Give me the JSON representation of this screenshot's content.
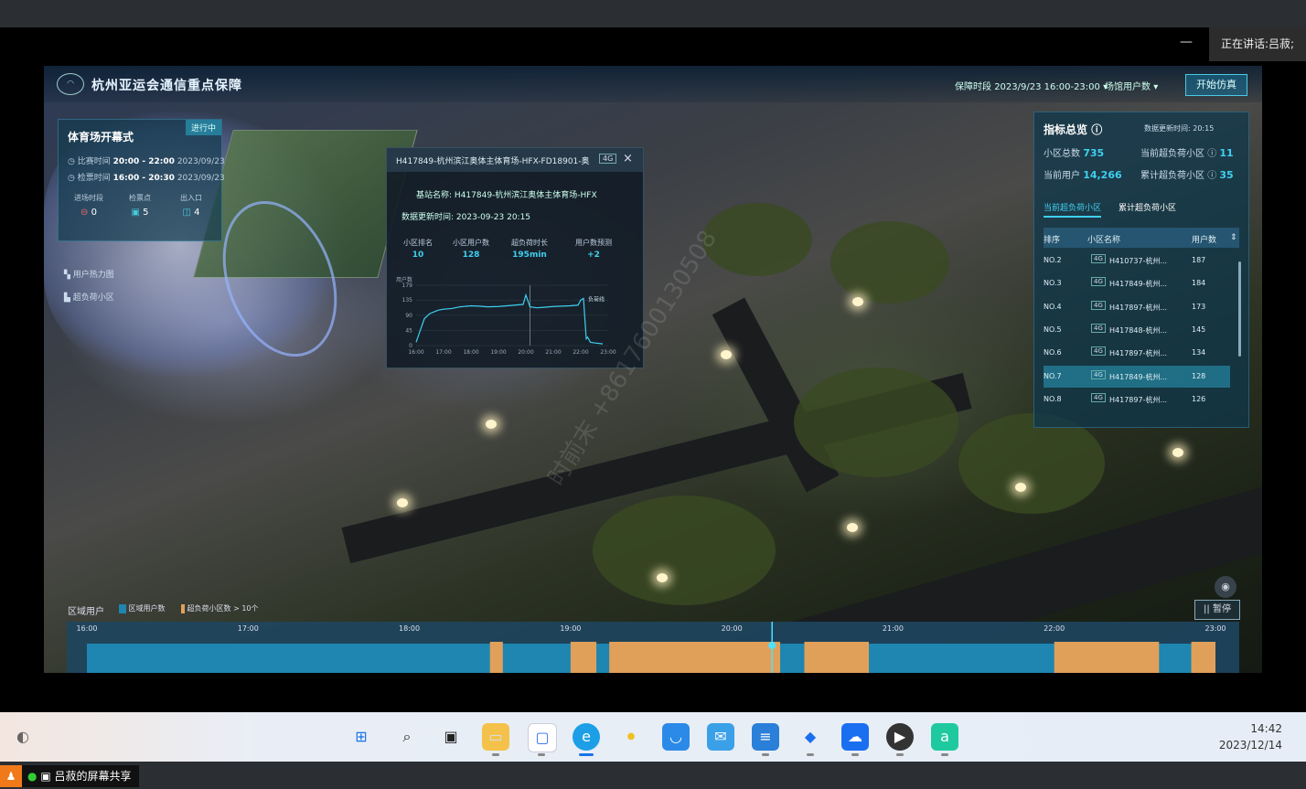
{
  "meeting": {
    "minimize_label": "—",
    "speaking_label": "正在讲话:",
    "speaker_name": "吕菽;",
    "share_label": "吕菽的屏幕共享"
  },
  "app": {
    "title": "杭州亚运会通信重点保障",
    "guard_period_label": "保障时段",
    "guard_period_value": "2023/9/23 16:00-23:00",
    "scene_label": "场馆用户数",
    "simulate_button": "开始仿真"
  },
  "event": {
    "title": "体育场开幕式",
    "status": "进行中",
    "match_time_label": "比赛时间",
    "match_time_value": "20:00 - 22:00",
    "match_date": "2023/09/23",
    "check_time_label": "检票时间",
    "check_time_value": "16:00 - 20:30",
    "check_date": "2023/09/23",
    "stats": [
      {
        "label": "进场时段",
        "value": "0",
        "icon": "clock-icon"
      },
      {
        "label": "检票点",
        "value": "5",
        "icon": "ticket-icon"
      },
      {
        "label": "出入口",
        "value": "4",
        "icon": "gate-icon"
      }
    ],
    "side_links": [
      "用户热力图",
      "超负荷小区"
    ]
  },
  "popup": {
    "cell_id": "H417849-杭州滨江奥体主体育场-HFX-FD18901-奥",
    "net": "4G",
    "close": "×",
    "station_label": "基站名称:",
    "station_value": "H417849-杭州滨江奥体主体育场-HFX",
    "update_label": "数据更新时间:",
    "update_value": "2023-09-23 20:15",
    "metrics": [
      {
        "label": "小区排名",
        "value": "10"
      },
      {
        "label": "小区用户数",
        "value": "128"
      },
      {
        "label": "超负荷时长",
        "value": "195min"
      },
      {
        "label": "用户数预测",
        "value": "+2"
      }
    ],
    "chart_ylabel": "用户数",
    "chart_series_label": "负荷线"
  },
  "chart_data": {
    "type": "line",
    "ylabel": "用户数",
    "x_ticks": [
      "16:00",
      "17:00",
      "18:00",
      "19:00",
      "20:00",
      "21:00",
      "22:00",
      "23:00"
    ],
    "y_ticks": [
      0,
      45,
      90,
      135,
      179
    ],
    "ylim": [
      0,
      179
    ],
    "series": [
      {
        "name": "负荷线",
        "color": "#3fd0f0",
        "x": [
          16.0,
          16.15,
          16.3,
          16.5,
          16.8,
          17.0,
          17.3,
          17.6,
          18.0,
          18.3,
          18.6,
          19.0,
          19.3,
          19.6,
          19.9,
          20.0,
          20.15,
          20.4,
          20.7,
          21.0,
          21.3,
          21.6,
          21.9,
          22.0,
          22.1,
          22.2,
          22.25,
          22.35,
          22.5,
          22.8
        ],
        "y": [
          10,
          45,
          80,
          95,
          105,
          108,
          110,
          115,
          118,
          117,
          115,
          116,
          118,
          120,
          122,
          150,
          115,
          112,
          114,
          116,
          117,
          118,
          120,
          135,
          140,
          20,
          25,
          10,
          8,
          5
        ]
      }
    ],
    "grid": true
  },
  "overview": {
    "title": "指标总览",
    "update_label": "数据更新时间:",
    "update_value": "20:15",
    "cells_total_label": "小区总数",
    "cells_total_value": "735",
    "current_over_label": "当前超负荷小区",
    "current_over_value": "11",
    "users_label": "当前用户",
    "users_value": "14,266",
    "cumulative_over_label": "累计超负荷小区",
    "cumulative_over_value": "35",
    "tab_current": "当前超负荷小区",
    "tab_cumulative": "累计超负荷小区",
    "columns": [
      "排序",
      "小区名称",
      "用户数"
    ],
    "rows": [
      {
        "rank": "NO.2",
        "net": "4G",
        "name": "H410737-杭州...",
        "users": "187"
      },
      {
        "rank": "NO.3",
        "net": "4G",
        "name": "H417849-杭州...",
        "users": "184"
      },
      {
        "rank": "NO.4",
        "net": "4G",
        "name": "H417897-杭州...",
        "users": "173"
      },
      {
        "rank": "NO.5",
        "net": "4G",
        "name": "H417848-杭州...",
        "users": "145"
      },
      {
        "rank": "NO.6",
        "net": "4G",
        "name": "H417897-杭州...",
        "users": "134"
      },
      {
        "rank": "NO.7",
        "net": "4G",
        "name": "H417849-杭州...",
        "users": "128"
      },
      {
        "rank": "NO.8",
        "net": "4G",
        "name": "H417897-杭州...",
        "users": "126"
      }
    ]
  },
  "timeline": {
    "title": "区域用户",
    "legend_users": "区域用户数",
    "legend_over": "超负荷小区数 > 10个",
    "pause_label": "|| 暂停",
    "ticks": [
      "16:00",
      "17:00",
      "18:00",
      "19:00",
      "20:00",
      "21:00",
      "22:00",
      "23:00"
    ],
    "colors": {
      "users": "#1e86b0",
      "over": "#e0a05a"
    }
  },
  "taskbar": {
    "time": "14:42",
    "date": "2023/12/14"
  },
  "watermark": "时前末 +8617600130508"
}
